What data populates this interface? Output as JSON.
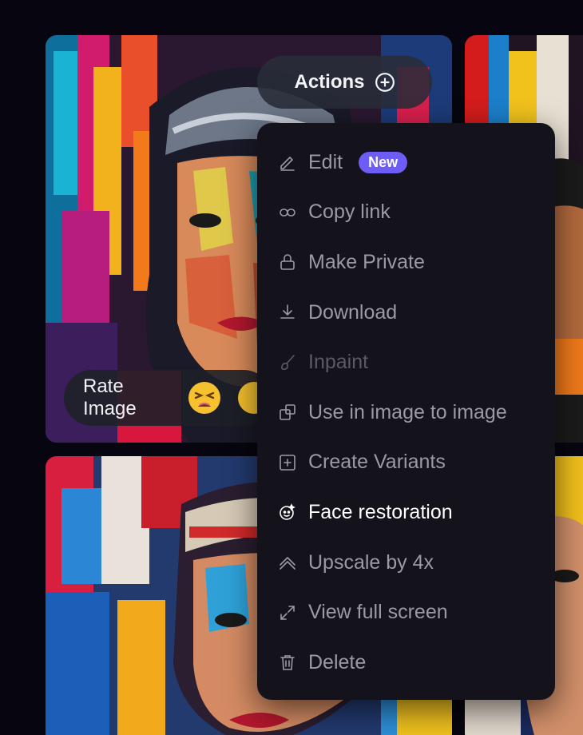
{
  "actions_button": {
    "label": "Actions",
    "icon": "plus-circle-icon"
  },
  "rate_pill": {
    "label": "Rate Image",
    "emoji": "tired-face-icon"
  },
  "menu": {
    "items": [
      {
        "label": "Edit",
        "icon": "pencil-icon",
        "badge": "New",
        "state": "normal"
      },
      {
        "label": "Copy link",
        "icon": "link-icon",
        "state": "normal"
      },
      {
        "label": "Make Private",
        "icon": "lock-icon",
        "state": "normal"
      },
      {
        "label": "Download",
        "icon": "download-icon",
        "state": "normal"
      },
      {
        "label": "Inpaint",
        "icon": "brush-icon",
        "state": "disabled"
      },
      {
        "label": "Use in image to image",
        "icon": "image-to-image-icon",
        "state": "normal"
      },
      {
        "label": "Create Variants",
        "icon": "plus-square-icon",
        "state": "normal"
      },
      {
        "label": "Face restoration",
        "icon": "face-restore-icon",
        "state": "highlight"
      },
      {
        "label": "Upscale by 4x",
        "icon": "upscale-icon",
        "state": "normal"
      },
      {
        "label": "View full screen",
        "icon": "expand-icon",
        "state": "normal"
      },
      {
        "label": "Delete",
        "icon": "trash-icon",
        "state": "normal"
      }
    ]
  },
  "colors": {
    "background": "#07050f",
    "menu_bg": "#14131c",
    "badge_bg": "#6d5cf6",
    "text_muted": "#9b9aa3",
    "text_disabled": "#5b5a63",
    "text_highlight": "#ffffff"
  }
}
